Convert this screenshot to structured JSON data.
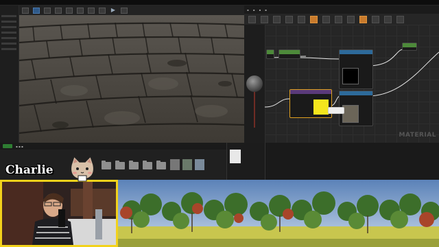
{
  "streamer": {
    "name": "Charlie"
  },
  "material_editor": {
    "watermark": "MATERIAL"
  },
  "colors": {
    "webcam_border": "#f2d21b",
    "selected_node": "#e0a020",
    "preview_swatch": "#f4e51d"
  },
  "icons": [
    "play-icon",
    "folder-icon",
    "cat-mascot-icon"
  ]
}
